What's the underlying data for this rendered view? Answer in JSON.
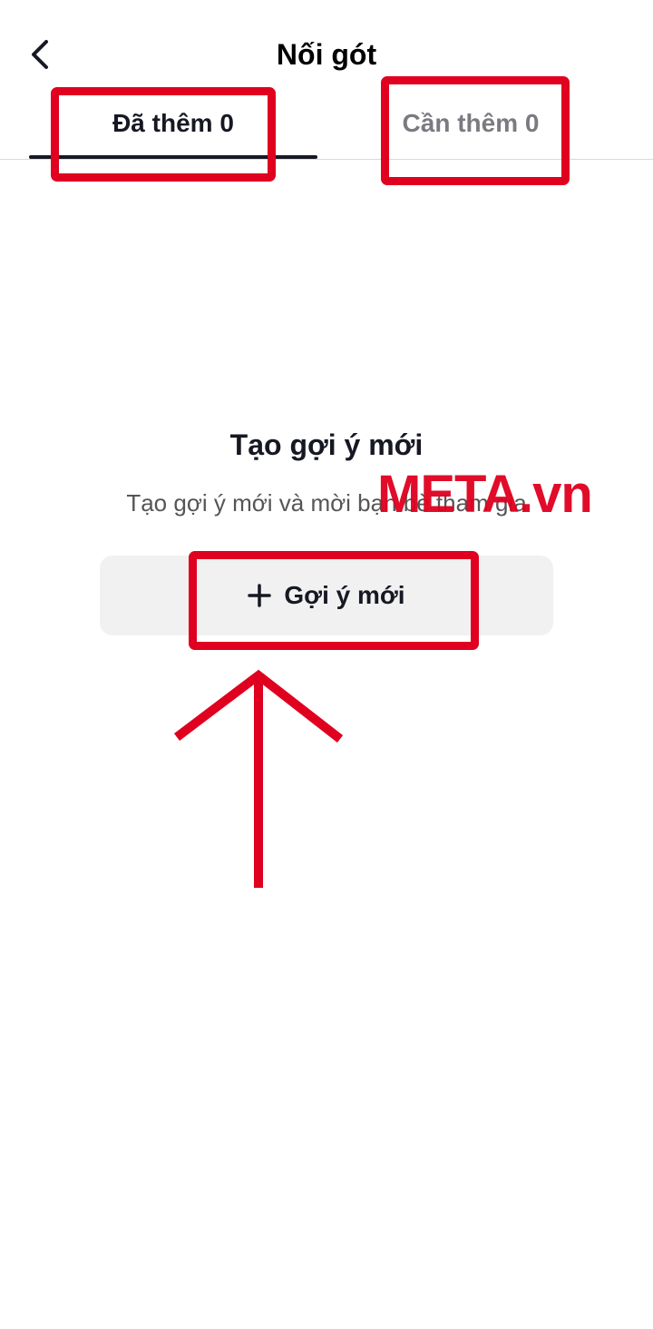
{
  "header": {
    "title": "Nối gót",
    "back_icon": "chevron-left-icon"
  },
  "tabs": [
    {
      "label": "Đã thêm 0",
      "active": true
    },
    {
      "label": "Cần thêm 0",
      "active": false
    }
  ],
  "empty_state": {
    "title": "Tạo gợi ý mới",
    "subtitle": "Tạo gợi ý mới và mời bạn bè tham gia"
  },
  "new_button": {
    "label": "Gợi ý mới",
    "icon": "plus-icon"
  },
  "watermark": {
    "text": "META.vn"
  },
  "colors": {
    "annotation": "#e0001f",
    "text_primary": "#161823",
    "text_secondary": "#7a7b80",
    "button_bg": "#f1f1f2"
  }
}
